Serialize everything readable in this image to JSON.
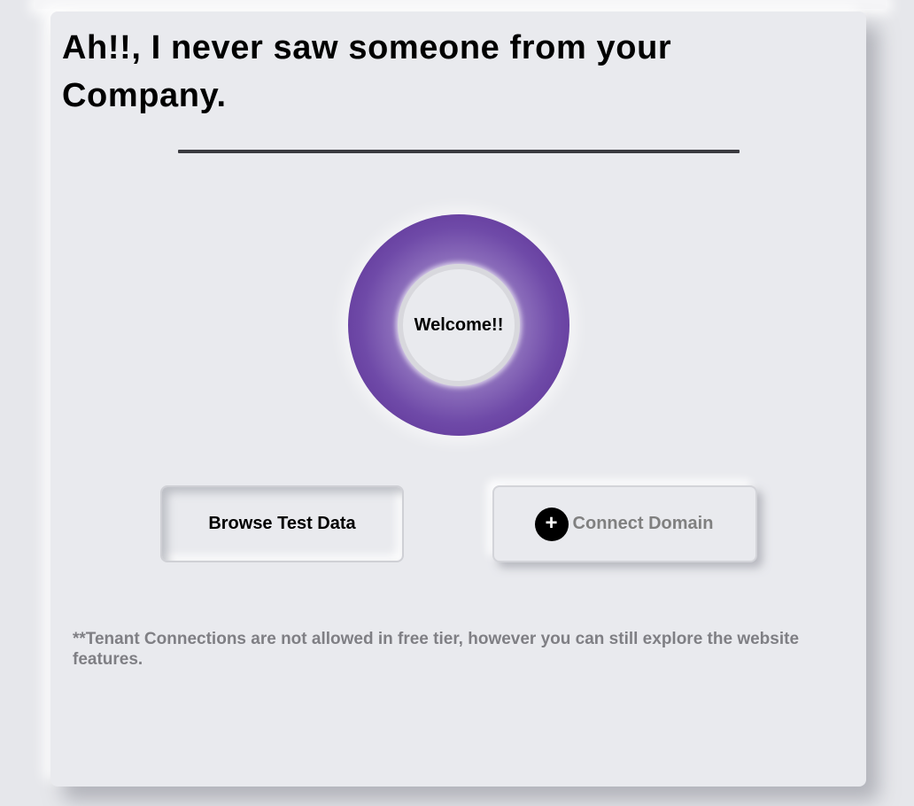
{
  "header": {
    "title": "Ah!!, I never saw someone from your Company."
  },
  "welcome_ring": {
    "label": "Welcome!!"
  },
  "actions": {
    "browse_label": "Browse Test Data",
    "connect_icon": "+",
    "connect_label": "Connect Domain"
  },
  "footer": {
    "note": "**Tenant Connections are not allowed in free tier, however you can still explore the website features."
  },
  "colors": {
    "ring_outer": "#55288e",
    "ring_mid": "#9c82c6",
    "background": "#e9eaee",
    "disabled_text": "#808080"
  }
}
